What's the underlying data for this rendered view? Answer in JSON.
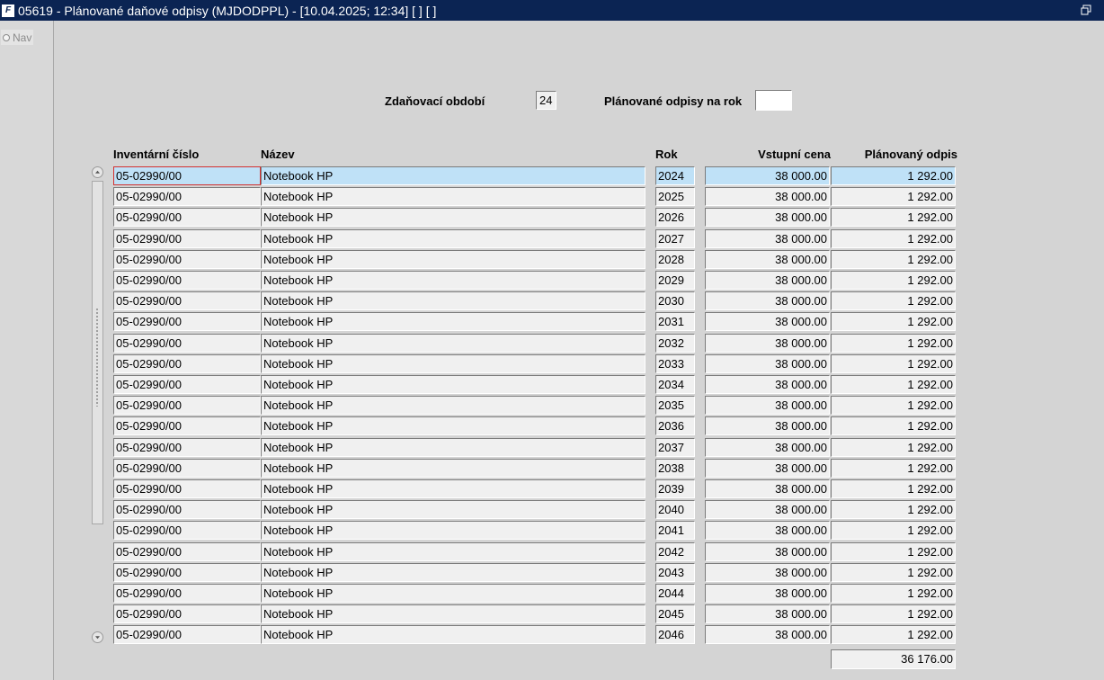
{
  "window": {
    "title": "05619 - Plánované daňové odpisy (MJDODPPL) - [10.04.2025; 12:34]  [ ]  [ ]",
    "icon": "oracle-forms-icon"
  },
  "nav": {
    "tab_label": "Nav"
  },
  "header": {
    "period_label": "Zdaňovací období",
    "period_value": "24",
    "planned_label": "Plánované odpisy na rok",
    "planned_value": ""
  },
  "table": {
    "columns": {
      "inventory": "Inventární číslo",
      "name": "Název",
      "year": "Rok",
      "input_price": "Vstupní cena",
      "planned": "Plánovaný odpis"
    },
    "rows": [
      {
        "inventory": "05-02990/00",
        "name": "Notebook HP",
        "year": "2024",
        "input_price": "38 000.00",
        "planned": "1 292.00"
      },
      {
        "inventory": "05-02990/00",
        "name": "Notebook HP",
        "year": "2025",
        "input_price": "38 000.00",
        "planned": "1 292.00"
      },
      {
        "inventory": "05-02990/00",
        "name": "Notebook HP",
        "year": "2026",
        "input_price": "38 000.00",
        "planned": "1 292.00"
      },
      {
        "inventory": "05-02990/00",
        "name": "Notebook HP",
        "year": "2027",
        "input_price": "38 000.00",
        "planned": "1 292.00"
      },
      {
        "inventory": "05-02990/00",
        "name": "Notebook HP",
        "year": "2028",
        "input_price": "38 000.00",
        "planned": "1 292.00"
      },
      {
        "inventory": "05-02990/00",
        "name": "Notebook HP",
        "year": "2029",
        "input_price": "38 000.00",
        "planned": "1 292.00"
      },
      {
        "inventory": "05-02990/00",
        "name": "Notebook HP",
        "year": "2030",
        "input_price": "38 000.00",
        "planned": "1 292.00"
      },
      {
        "inventory": "05-02990/00",
        "name": "Notebook HP",
        "year": "2031",
        "input_price": "38 000.00",
        "planned": "1 292.00"
      },
      {
        "inventory": "05-02990/00",
        "name": "Notebook HP",
        "year": "2032",
        "input_price": "38 000.00",
        "planned": "1 292.00"
      },
      {
        "inventory": "05-02990/00",
        "name": "Notebook HP",
        "year": "2033",
        "input_price": "38 000.00",
        "planned": "1 292.00"
      },
      {
        "inventory": "05-02990/00",
        "name": "Notebook HP",
        "year": "2034",
        "input_price": "38 000.00",
        "planned": "1 292.00"
      },
      {
        "inventory": "05-02990/00",
        "name": "Notebook HP",
        "year": "2035",
        "input_price": "38 000.00",
        "planned": "1 292.00"
      },
      {
        "inventory": "05-02990/00",
        "name": "Notebook HP",
        "year": "2036",
        "input_price": "38 000.00",
        "planned": "1 292.00"
      },
      {
        "inventory": "05-02990/00",
        "name": "Notebook HP",
        "year": "2037",
        "input_price": "38 000.00",
        "planned": "1 292.00"
      },
      {
        "inventory": "05-02990/00",
        "name": "Notebook HP",
        "year": "2038",
        "input_price": "38 000.00",
        "planned": "1 292.00"
      },
      {
        "inventory": "05-02990/00",
        "name": "Notebook HP",
        "year": "2039",
        "input_price": "38 000.00",
        "planned": "1 292.00"
      },
      {
        "inventory": "05-02990/00",
        "name": "Notebook HP",
        "year": "2040",
        "input_price": "38 000.00",
        "planned": "1 292.00"
      },
      {
        "inventory": "05-02990/00",
        "name": "Notebook HP",
        "year": "2041",
        "input_price": "38 000.00",
        "planned": "1 292.00"
      },
      {
        "inventory": "05-02990/00",
        "name": "Notebook HP",
        "year": "2042",
        "input_price": "38 000.00",
        "planned": "1 292.00"
      },
      {
        "inventory": "05-02990/00",
        "name": "Notebook HP",
        "year": "2043",
        "input_price": "38 000.00",
        "planned": "1 292.00"
      },
      {
        "inventory": "05-02990/00",
        "name": "Notebook HP",
        "year": "2044",
        "input_price": "38 000.00",
        "planned": "1 292.00"
      },
      {
        "inventory": "05-02990/00",
        "name": "Notebook HP",
        "year": "2045",
        "input_price": "38 000.00",
        "planned": "1 292.00"
      },
      {
        "inventory": "05-02990/00",
        "name": "Notebook HP",
        "year": "2046",
        "input_price": "38 000.00",
        "planned": "1 292.00"
      }
    ],
    "total_planned": "36 176.00"
  },
  "colors": {
    "titlebar": "#0b2453",
    "background": "#d4d4d4",
    "selected_row": "#bfe1f7",
    "focus_border": "#d23131"
  }
}
